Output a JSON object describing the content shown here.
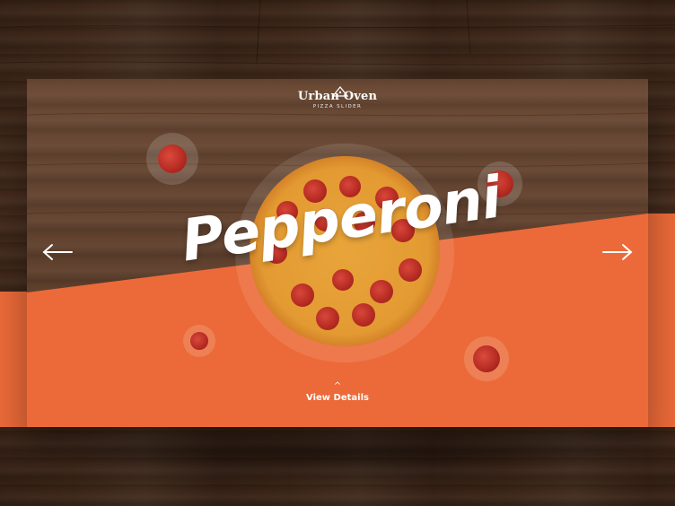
{
  "brand": {
    "name": "Urban Oven",
    "tagline": "PIZZA SLIDER",
    "icon": "pizza-slice-icon"
  },
  "slide": {
    "title": "Pepperoni"
  },
  "nav": {
    "prev_icon": "arrow-left-icon",
    "next_icon": "arrow-right-icon"
  },
  "details": {
    "label": "View Details",
    "icon": "chevron-up-icon"
  },
  "colors": {
    "accent": "#ec6a39",
    "text": "#ffffff",
    "wood": "#4a2f1f"
  }
}
